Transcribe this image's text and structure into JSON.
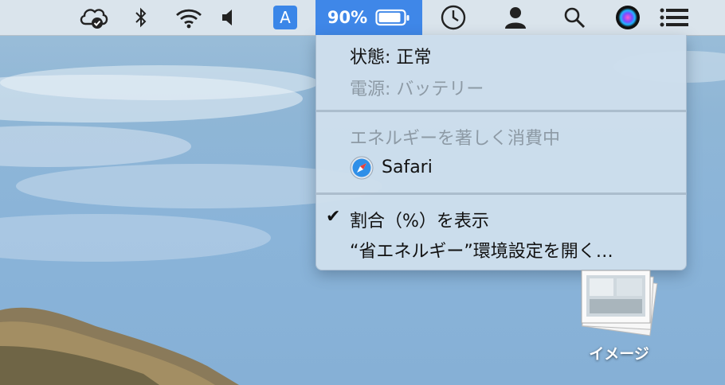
{
  "menubar": {
    "icons": [
      "icloud-sync-icon",
      "bluetooth-icon",
      "wifi-icon",
      "volume-icon",
      "input-source-icon",
      "battery-icon",
      "clock-icon",
      "user-icon",
      "spotlight-icon",
      "siri-icon",
      "notification-center-icon"
    ],
    "ime_label": "A",
    "battery_percent": "90%",
    "battery_level": 0.9,
    "accent_color": "#3f87e8"
  },
  "menu": {
    "status": "状態: 正常",
    "power_source": "電源: バッテリー",
    "energy_header": "エネルギーを著しく消費中",
    "apps": [
      {
        "name": "Safari",
        "icon": "safari-icon"
      }
    ],
    "show_percent": "割合（%）を表示",
    "show_percent_checked": true,
    "open_prefs": "“省エネルギー”環境設定を開く…"
  },
  "desktop": {
    "file_label": "イメージ"
  }
}
